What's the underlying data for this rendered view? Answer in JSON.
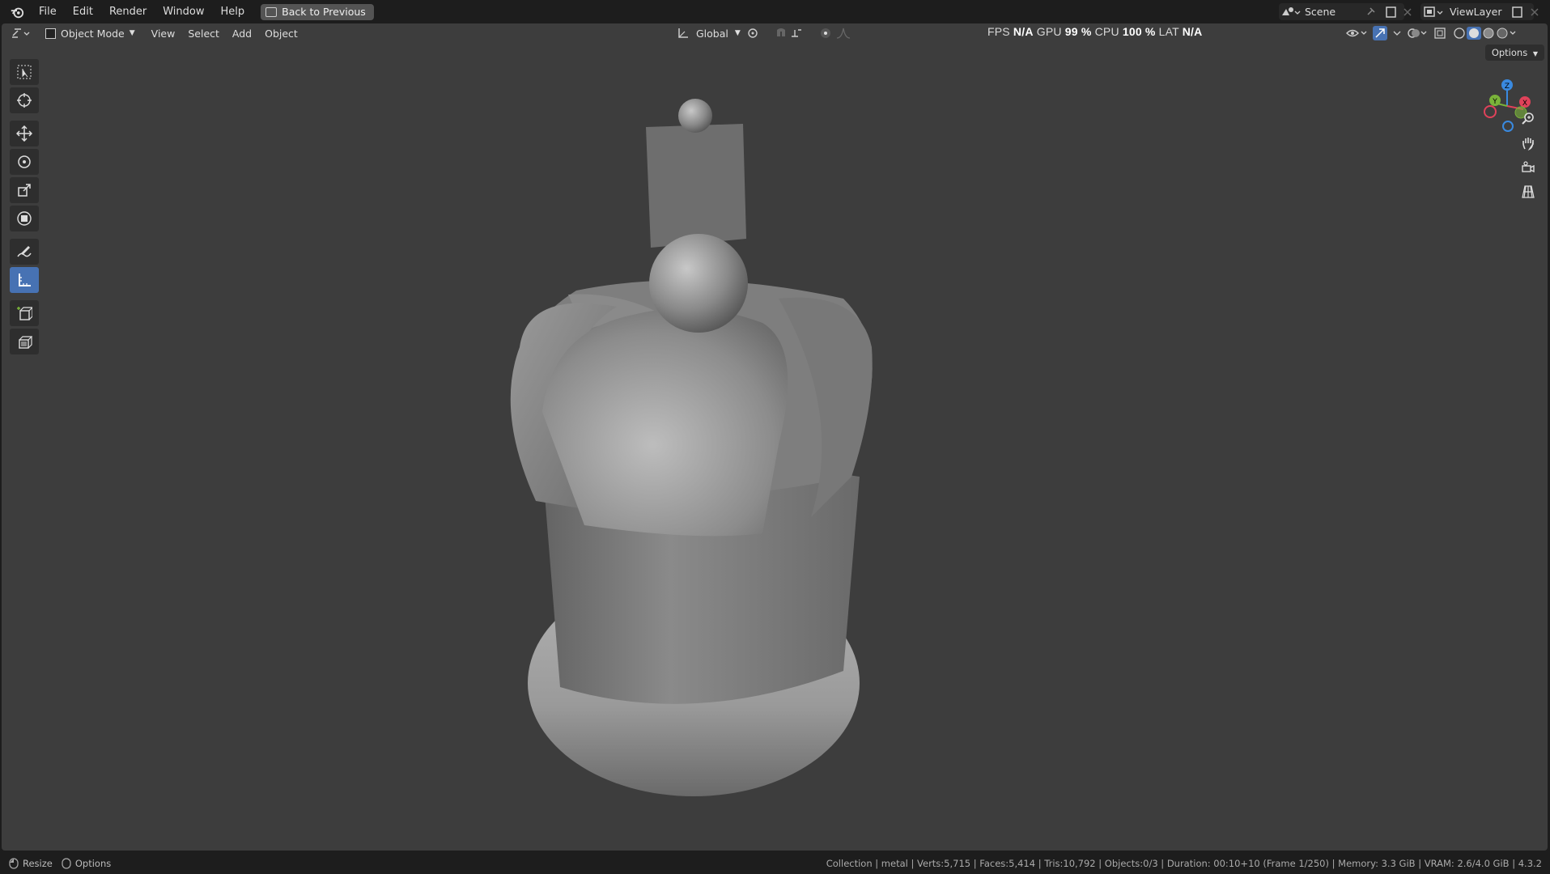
{
  "menu": {
    "items": [
      "File",
      "Edit",
      "Render",
      "Window",
      "Help"
    ],
    "back_label": "Back to Previous"
  },
  "scene": {
    "label": "Scene"
  },
  "view_layer": {
    "label": "ViewLayer"
  },
  "header": {
    "mode": "Object Mode",
    "view": "View",
    "select": "Select",
    "add": "Add",
    "object": "Object",
    "orientation": "Global",
    "options": "Options"
  },
  "stats": {
    "fps_label": "FPS",
    "fps_value": "N/A",
    "gpu_label": "GPU",
    "gpu_value": "99 %",
    "cpu_label": "CPU",
    "cpu_value": "100 %",
    "lat_label": "LAT",
    "lat_value": "N/A"
  },
  "gizmo": {
    "z": "Z",
    "y": "Y",
    "x": "X"
  },
  "toolbar": {
    "tools": [
      "select-box",
      "cursor",
      "move",
      "rotate",
      "scale",
      "transform",
      "annotate",
      "measure",
      "add-cube",
      "extrude"
    ],
    "active": "measure"
  },
  "status": {
    "left_1": "Resize",
    "left_2": "Options",
    "right": "Collection | metal | Verts:5,715 | Faces:5,414 | Tris:10,792 | Objects:0/3 | Duration: 00:10+10 (Frame 1/250) | Memory: 3.3 GiB | VRAM: 2.6/4.0 GiB | 4.3.2"
  },
  "colors": {
    "accent": "#4772b3",
    "viewport_bg": "#3d3d3d",
    "topbar_bg": "#1d1d1d",
    "axis_x": "#e0425a",
    "axis_y": "#7ab33a",
    "axis_z": "#3a8ae0"
  }
}
